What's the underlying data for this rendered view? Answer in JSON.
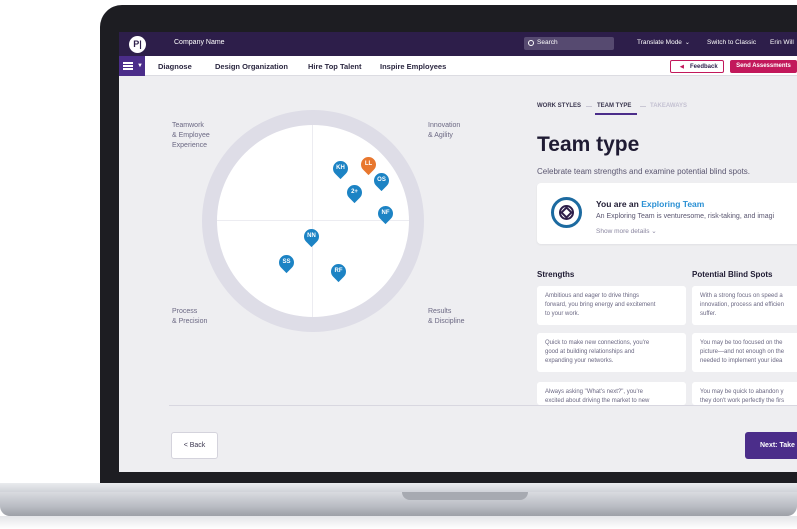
{
  "topbar": {
    "logo": "P|",
    "company": "Company Name",
    "search_placeholder": "Search",
    "translate_mode": "Translate Mode",
    "switch_classic": "Switch to Classic",
    "user": "Erin Will"
  },
  "nav": {
    "items": [
      "Diagnose",
      "Design Organization",
      "Hire Top Talent",
      "Inspire Employees"
    ],
    "feedback": "Feedback",
    "send": "Send Assessments"
  },
  "chart": {
    "quadrants": {
      "top_left": [
        "Teamwork",
        "& Employee",
        "Experience"
      ],
      "top_right": [
        "Innovation",
        "& Agility"
      ],
      "bottom_left": [
        "Process",
        "& Precision"
      ],
      "bottom_right": [
        "Results",
        "& Discipline"
      ]
    },
    "pins": [
      {
        "label": "KH",
        "color": "#1c83c4"
      },
      {
        "label": "LL",
        "color": "#e8772e"
      },
      {
        "label": "OS",
        "color": "#1c83c4"
      },
      {
        "label": "2+",
        "color": "#1c83c4"
      },
      {
        "label": "NF",
        "color": "#1c83c4"
      },
      {
        "label": "NN",
        "color": "#1c83c4"
      },
      {
        "label": "SS",
        "color": "#1c83c4"
      },
      {
        "label": "RF",
        "color": "#1c83c4"
      }
    ]
  },
  "tabs": [
    "WORK STYLES",
    "TEAM TYPE",
    "TAKEAWAYS"
  ],
  "page": {
    "title": "Team type",
    "subtitle": "Celebrate team strengths and examine potential blind spots."
  },
  "type_card": {
    "heading_prefix": "You are an ",
    "team_name": "Exploring Team",
    "description": "An Exploring Team is venturesome, risk-taking, and imagi",
    "show_more": "Show more details"
  },
  "strengths": {
    "title": "Strengths",
    "items": [
      [
        "Ambitious and eager to drive things",
        "forward, you bring energy and excitement",
        "to your work."
      ],
      [
        "Quick to make new connections, you're",
        "good at building relationships and",
        "expanding your networks."
      ],
      [
        "Always asking \"What's next?\", you're",
        "excited about driving the market to new"
      ]
    ]
  },
  "blind_spots": {
    "title": "Potential Blind Spots",
    "items": [
      [
        "With a strong focus on speed a",
        "innovation, process and efficien",
        "suffer."
      ],
      [
        "You may be too focused on the",
        "picture—and not enough on the",
        "needed to implement your idea"
      ],
      [
        "You may be quick to abandon y",
        "they don't work perfectly the firs"
      ]
    ]
  },
  "footer": {
    "back": "< Back",
    "next": "Next: Take"
  },
  "colors": {
    "primary": "#4b2d8a",
    "topbar": "#2d1e4a",
    "accent": "#c2185b",
    "pin_blue": "#1c83c4",
    "pin_orange": "#e8772e",
    "link": "#2a90d4"
  }
}
